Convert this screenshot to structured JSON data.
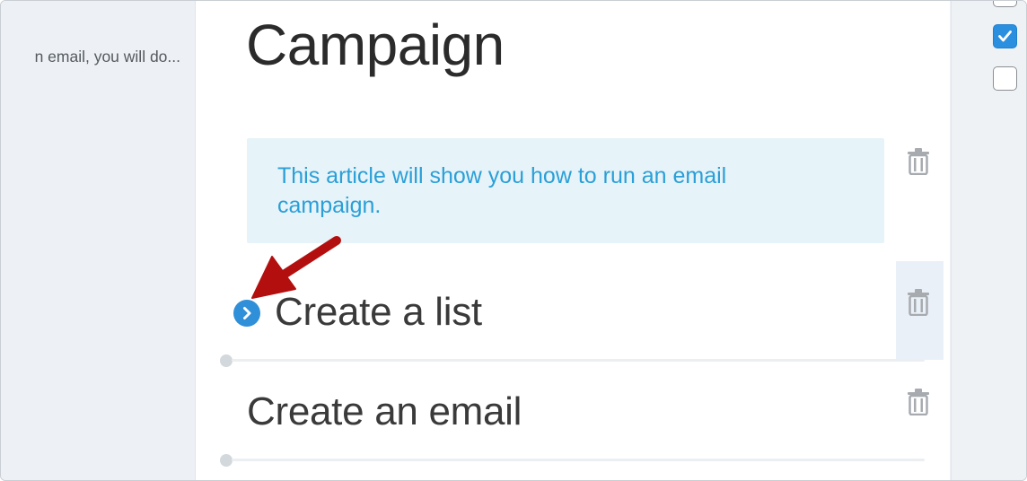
{
  "left_panel": {
    "snippet": "n email, you will do..."
  },
  "main": {
    "title": "Campaign",
    "info_box": {
      "text": "This article will show you how to run an email campaign."
    },
    "steps": [
      {
        "title": "Create a list"
      },
      {
        "title": "Create an email"
      }
    ]
  },
  "right_panel": {
    "checkboxes": [
      {
        "state": "unchecked"
      },
      {
        "state": "checked"
      },
      {
        "state": "unchecked"
      }
    ]
  },
  "colors": {
    "accent": "#2a9fd8",
    "info_bg": "#e6f3f8",
    "annotation_arrow": "#c00000",
    "checkbox_checked": "#2b8fe0"
  },
  "icons": {
    "trash": "trash-icon",
    "expand": "chevron-right-icon",
    "checkmark": "checkmark-icon",
    "annotation": "annotation-arrow"
  }
}
